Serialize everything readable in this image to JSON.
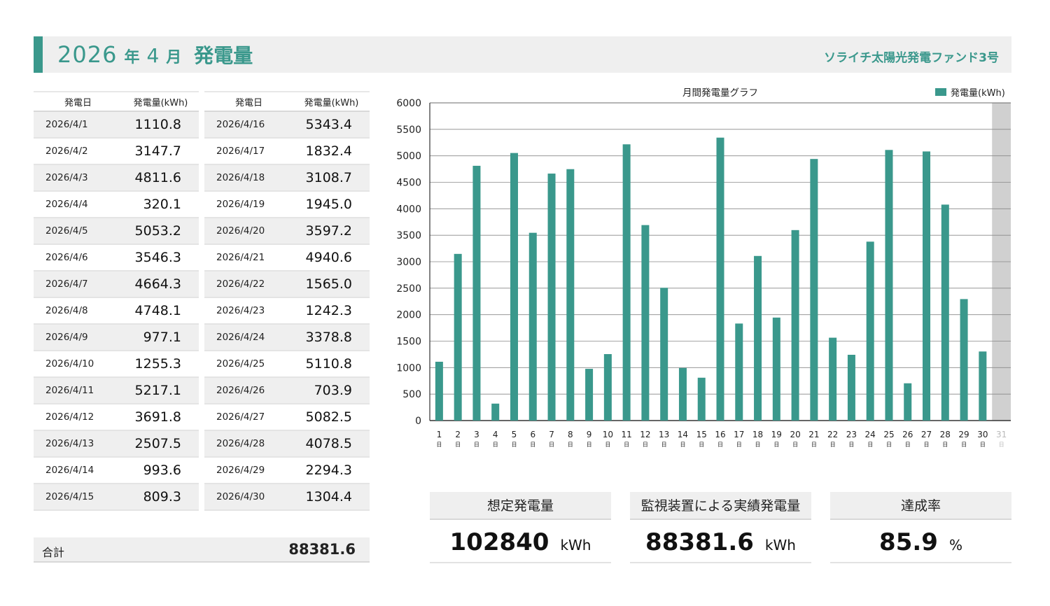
{
  "header": {
    "year": "2026",
    "year_unit": "年",
    "month": "4",
    "month_unit": "月",
    "label": "発電量",
    "fund_name": "ソライチ太陽光発電ファンド3号"
  },
  "tables": {
    "date_header": "発電日",
    "value_header": "発電量(kWh)",
    "left_rows": [
      {
        "date": "2026/4/1",
        "value": "1110.8"
      },
      {
        "date": "2026/4/2",
        "value": "3147.7"
      },
      {
        "date": "2026/4/3",
        "value": "4811.6"
      },
      {
        "date": "2026/4/4",
        "value": "320.1"
      },
      {
        "date": "2026/4/5",
        "value": "5053.2"
      },
      {
        "date": "2026/4/6",
        "value": "3546.3"
      },
      {
        "date": "2026/4/7",
        "value": "4664.3"
      },
      {
        "date": "2026/4/8",
        "value": "4748.1"
      },
      {
        "date": "2026/4/9",
        "value": "977.1"
      },
      {
        "date": "2026/4/10",
        "value": "1255.3"
      },
      {
        "date": "2026/4/11",
        "value": "5217.1"
      },
      {
        "date": "2026/4/12",
        "value": "3691.8"
      },
      {
        "date": "2026/4/13",
        "value": "2507.5"
      },
      {
        "date": "2026/4/14",
        "value": "993.6"
      },
      {
        "date": "2026/4/15",
        "value": "809.3"
      }
    ],
    "right_rows": [
      {
        "date": "2026/4/16",
        "value": "5343.4"
      },
      {
        "date": "2026/4/17",
        "value": "1832.4"
      },
      {
        "date": "2026/4/18",
        "value": "3108.7"
      },
      {
        "date": "2026/4/19",
        "value": "1945.0"
      },
      {
        "date": "2026/4/20",
        "value": "3597.2"
      },
      {
        "date": "2026/4/21",
        "value": "4940.6"
      },
      {
        "date": "2026/4/22",
        "value": "1565.0"
      },
      {
        "date": "2026/4/23",
        "value": "1242.3"
      },
      {
        "date": "2026/4/24",
        "value": "3378.8"
      },
      {
        "date": "2026/4/25",
        "value": "5110.8"
      },
      {
        "date": "2026/4/26",
        "value": "703.9"
      },
      {
        "date": "2026/4/27",
        "value": "5082.5"
      },
      {
        "date": "2026/4/28",
        "value": "4078.5"
      },
      {
        "date": "2026/4/29",
        "value": "2294.3"
      },
      {
        "date": "2026/4/30",
        "value": "1304.4"
      }
    ]
  },
  "total": {
    "label": "合計",
    "value": "88381.6"
  },
  "summary": {
    "expected": {
      "label": "想定発電量",
      "value": "102840",
      "unit": "kWh"
    },
    "actual": {
      "label": "監視装置による実績発電量",
      "value": "88381.6",
      "unit": "kWh"
    },
    "rate": {
      "label": "達成率",
      "value": "85.9",
      "unit": "%"
    }
  },
  "colors": {
    "accent": "#3a988c",
    "bar": "#3a988c",
    "header_bg": "#efefef",
    "disabled_day": "#d0d0d0"
  },
  "chart_data": {
    "type": "bar",
    "title": "月間発電量グラフ",
    "legend": "top-right",
    "categories": [
      "1",
      "2",
      "3",
      "4",
      "5",
      "6",
      "7",
      "8",
      "9",
      "10",
      "11",
      "12",
      "13",
      "14",
      "15",
      "16",
      "17",
      "18",
      "19",
      "20",
      "21",
      "22",
      "23",
      "24",
      "25",
      "26",
      "27",
      "28",
      "29",
      "30",
      "31"
    ],
    "category_suffix": "日",
    "disabled_categories": [
      "31"
    ],
    "series": [
      {
        "name": "発電量(kWh)",
        "values": [
          1110.8,
          3147.7,
          4811.6,
          320.1,
          5053.2,
          3546.3,
          4664.3,
          4748.1,
          977.1,
          1255.3,
          5217.1,
          3691.8,
          2507.5,
          993.6,
          809.3,
          5343.4,
          1832.4,
          3108.7,
          1945.0,
          3597.2,
          4940.6,
          1565.0,
          1242.3,
          3378.8,
          5110.8,
          703.9,
          5082.5,
          4078.5,
          2294.3,
          1304.4,
          null
        ]
      }
    ],
    "y_ticks": [
      0,
      500,
      1000,
      1500,
      2000,
      2500,
      3000,
      3500,
      4000,
      4500,
      5000,
      5500,
      6000
    ],
    "ylim": [
      0,
      6000
    ],
    "grid": true
  }
}
